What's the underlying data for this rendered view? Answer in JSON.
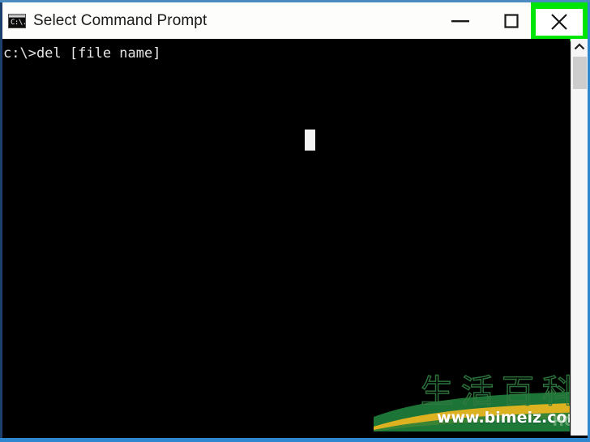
{
  "window": {
    "title": "Select Command Prompt",
    "icon": "command-prompt-icon",
    "icon_glyph": "C:\\.",
    "border_color": "#2f87d0",
    "titlebar_color": "#fdfdfb"
  },
  "controls": {
    "minimize_label": "—",
    "minimize_name": "minimize-button",
    "maximize_label": "☐",
    "maximize_name": "maximize-button",
    "close_label": "✕",
    "close_name": "close-button",
    "close_highlight_color": "#00e508"
  },
  "console": {
    "background": "#000000",
    "foreground": "#e6e6e6",
    "lines": [
      "c:\\>del [file name]"
    ],
    "text": "c:\\>del [file name]",
    "cursor_visible": true,
    "cursor_shape": "block"
  },
  "scrollbar": {
    "up_arrow": "ⱏ",
    "thumb_color": "#cdcdcd",
    "track_color": "#f6f6f6"
  },
  "watermark": {
    "characters": "生活百科",
    "url": "www.bimeiz.com",
    "corner_text": "HOW",
    "stroke_color": "#2f7a3f"
  }
}
